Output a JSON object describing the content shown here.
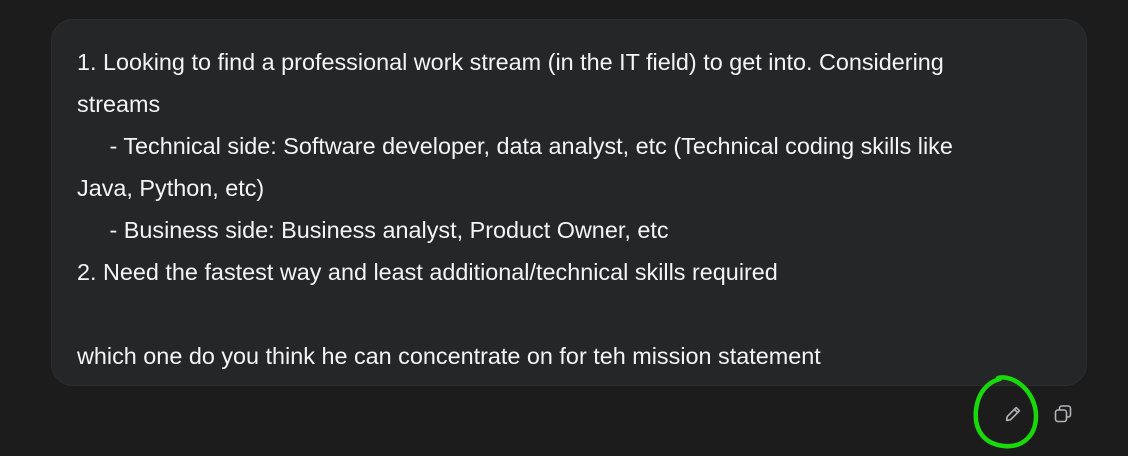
{
  "message": {
    "lines": [
      "1. Looking to find a professional work stream (in the IT field) to get into. Considering",
      "streams",
      "     - Technical side: Software developer, data analyst, etc (Technical coding skills like",
      "Java, Python, etc)",
      "     - Business side: Business analyst, Product Owner, etc",
      "2. Need the fastest way and least additional/technical skills required",
      "",
      "which one do you think he can concentrate on for teh mission statement"
    ]
  },
  "actions": {
    "edit_icon": "pencil-icon",
    "copy_icon": "copy-icon"
  },
  "colors": {
    "background": "#1c1c1d",
    "bubble": "#252628",
    "text": "#f4f4f5",
    "icon": "#b4b4b8",
    "highlight": "#18d90a"
  }
}
